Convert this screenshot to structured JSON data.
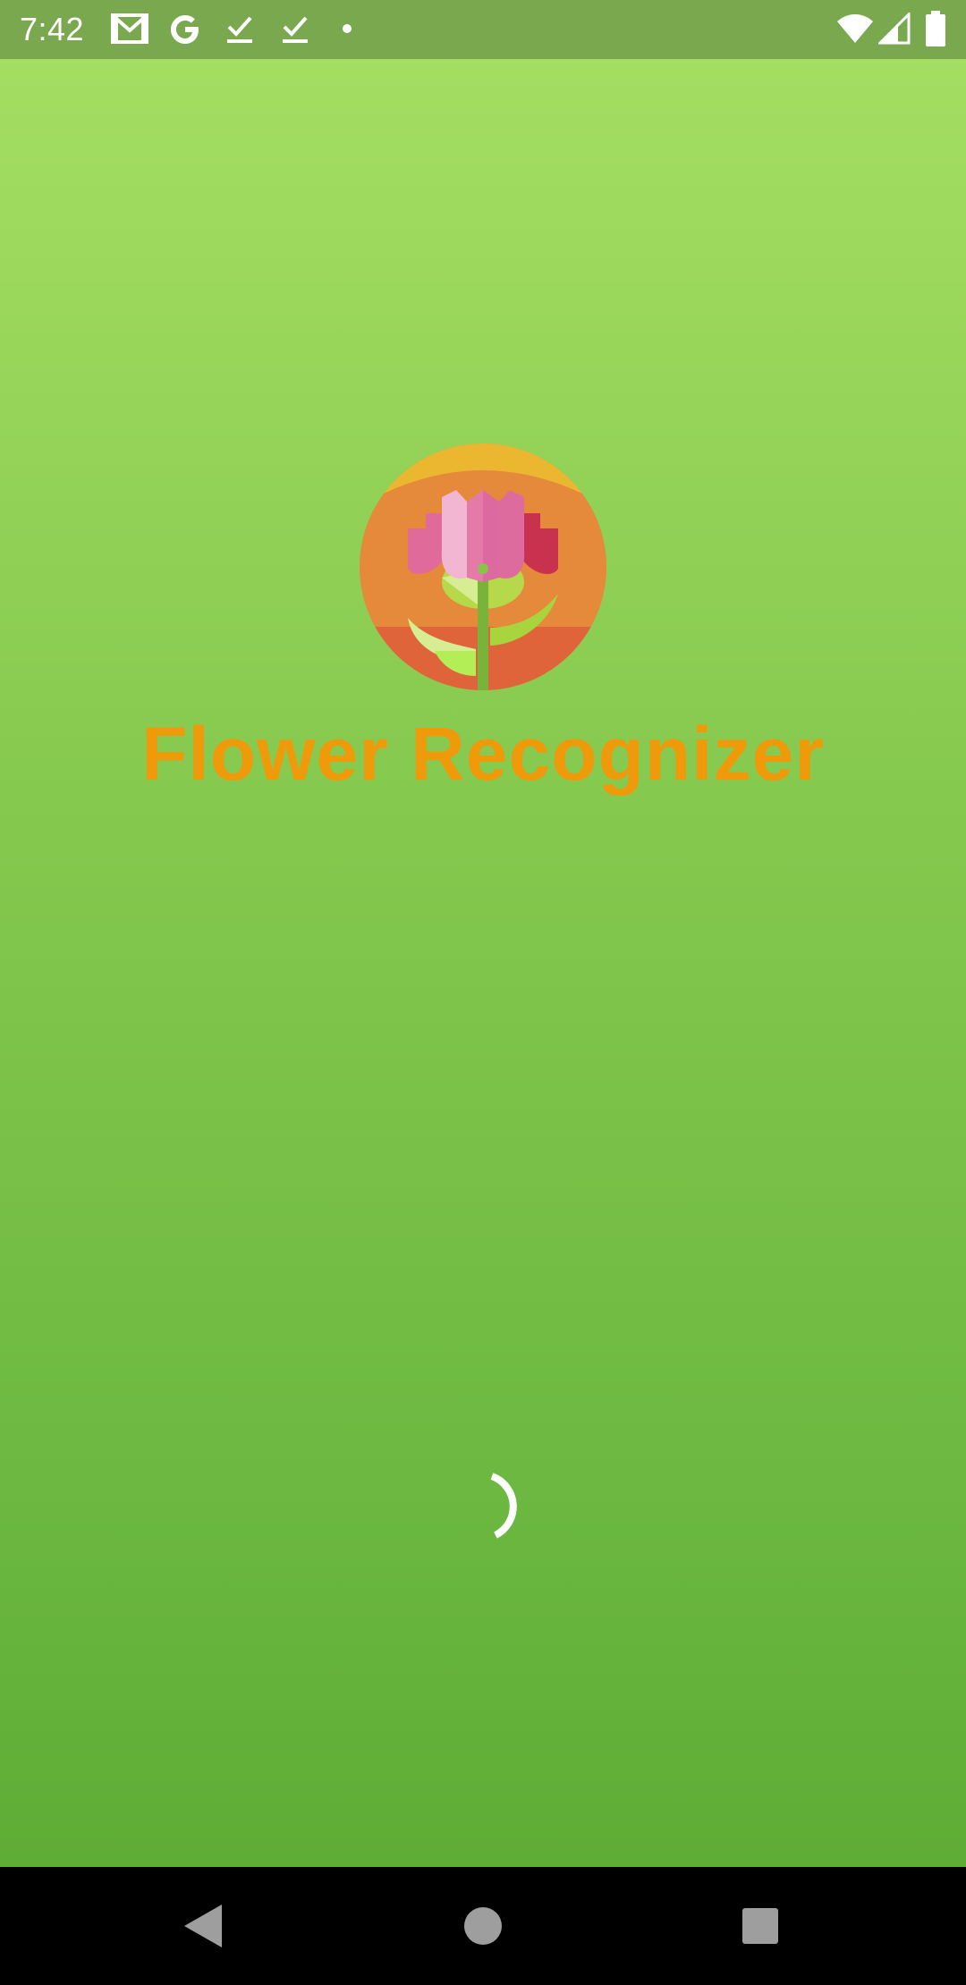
{
  "status_bar": {
    "time": "7:42",
    "notification_icons": [
      "gmail-icon",
      "google-icon",
      "download-done-icon",
      "download-done-icon",
      "dot-icon"
    ],
    "system_icons": [
      "wifi-icon",
      "cell-signal-icon",
      "battery-icon"
    ]
  },
  "splash": {
    "app_title": "Flower Recognizer",
    "logo_icon": "flower-logo-icon",
    "title_color": "#ef9a0a",
    "loading_indicator": "spinner-icon"
  },
  "nav_bar": {
    "buttons": [
      "back-icon",
      "home-icon",
      "recents-icon"
    ]
  },
  "colors": {
    "background_top": "#a6e063",
    "background_bottom": "#5aa932",
    "status_bar": "#7aa84f",
    "nav_bar": "#000000"
  }
}
